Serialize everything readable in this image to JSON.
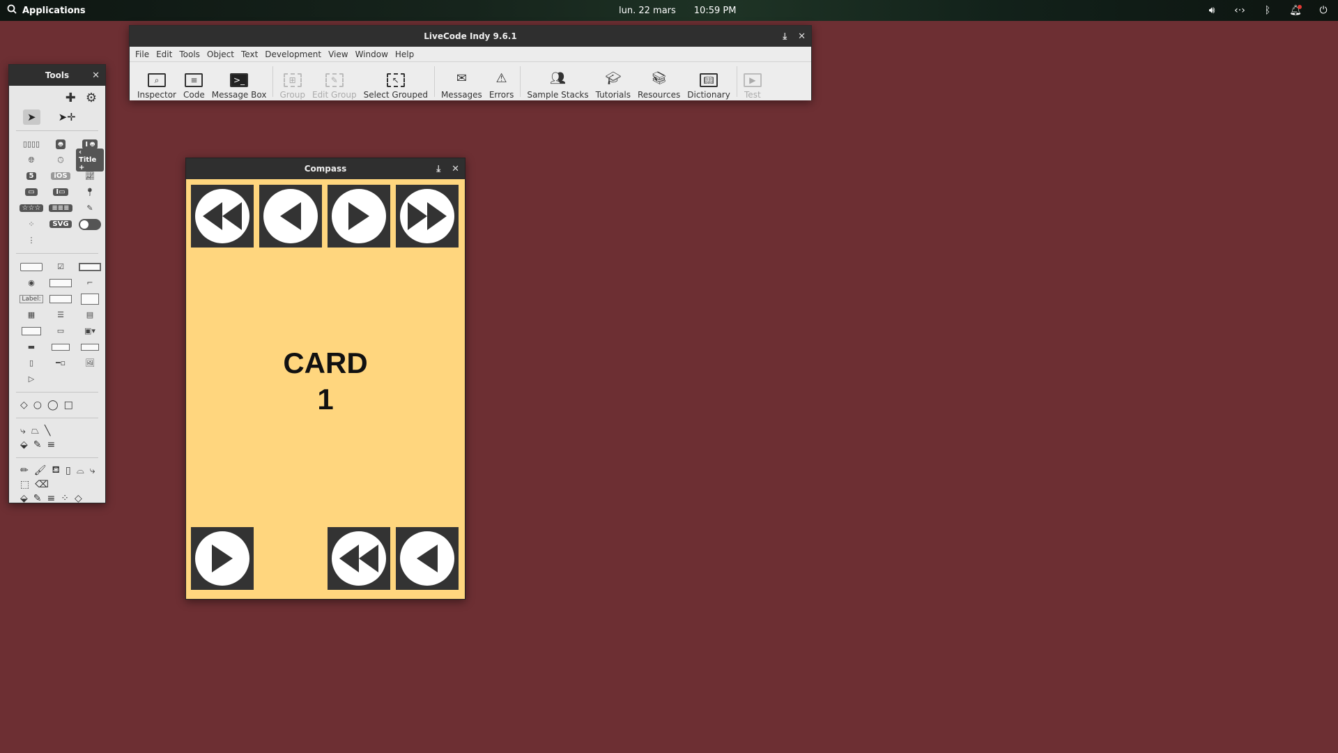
{
  "topbar": {
    "apps_label": "Applications",
    "date": "lun. 22 mars",
    "time": "10:59 PM",
    "tray_icons": [
      "volume-icon",
      "network-icon",
      "bluetooth-icon",
      "notifications-icon",
      "power-icon"
    ]
  },
  "main_window": {
    "title": "LiveCode Indy 9.6.1",
    "menus": [
      "File",
      "Edit",
      "Tools",
      "Object",
      "Text",
      "Development",
      "View",
      "Window",
      "Help"
    ],
    "toolbar": {
      "inspector": "Inspector",
      "code": "Code",
      "message_box": "Message Box",
      "group": "Group",
      "edit_group": "Edit Group",
      "select_grouped": "Select Grouped",
      "messages": "Messages",
      "errors": "Errors",
      "sample_stacks": "Sample Stacks",
      "tutorials": "Tutorials",
      "resources": "Resources",
      "dictionary": "Dictionary",
      "test": "Test"
    }
  },
  "tools_palette": {
    "title": "Tools",
    "widgets": {
      "title_bar": "‹ Title +",
      "ios": "iOS",
      "svg": "SVG"
    },
    "label_control": "Label:"
  },
  "compass": {
    "title": "Compass",
    "card_title": "CARD",
    "card_number": "1"
  },
  "colors": {
    "desktop": "#6d2f33",
    "card_background": "#ffd67e",
    "button_background": "#333333"
  }
}
